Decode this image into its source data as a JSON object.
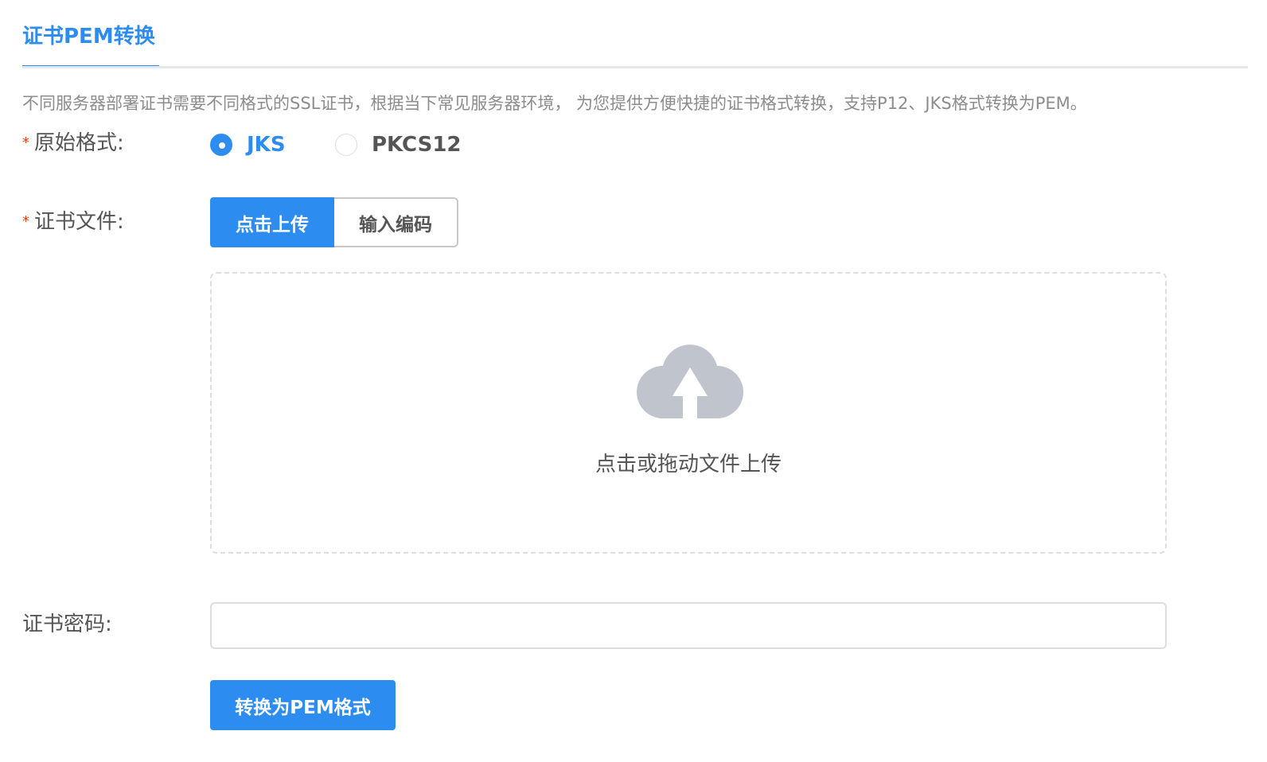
{
  "tabs": [
    {
      "label": "证书PEM转换",
      "active": true
    }
  ],
  "description": "不同服务器部署证书需要不同格式的SSL证书，根据当下常见服务器环境， 为您提供方便快捷的证书格式转换，支持P12、JKS格式转换为PEM。",
  "form": {
    "format": {
      "required_mark": "*",
      "label": "原始格式:",
      "options": [
        {
          "label": "JKS",
          "checked": true
        },
        {
          "label": "PKCS12",
          "checked": false
        }
      ]
    },
    "file": {
      "required_mark": "*",
      "label": "证书文件:",
      "modes": [
        {
          "label": "点击上传",
          "active": true
        },
        {
          "label": "输入编码",
          "active": false
        }
      ],
      "dropzone_text": "点击或拖动文件上传",
      "dropzone_icon": "cloud-upload-icon"
    },
    "password": {
      "label": "证书密码:",
      "value": "",
      "placeholder": ""
    },
    "submit_label": "转换为PEM格式"
  },
  "colors": {
    "primary": "#2d8cf0",
    "required": "#ed4014",
    "icon_gray": "#c0c4cc",
    "border": "#dcdee2"
  }
}
